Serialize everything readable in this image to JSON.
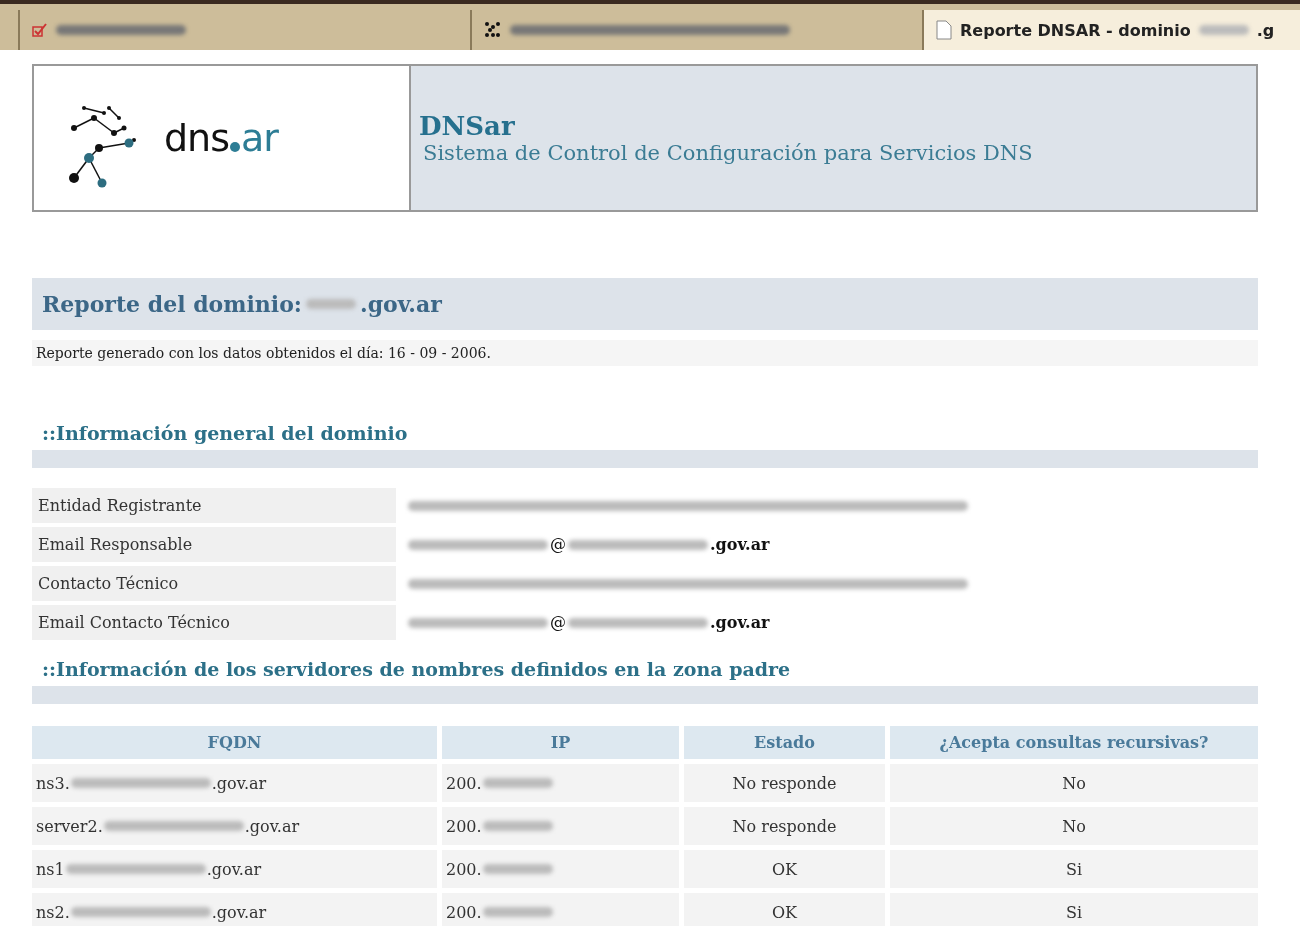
{
  "tabs": [
    {
      "selected": false,
      "parts": [
        {
          "kind": "blur"
        }
      ]
    },
    {
      "selected": false,
      "parts": [
        {
          "kind": "blur"
        }
      ]
    },
    {
      "selected": true,
      "parts": [
        {
          "kind": "text",
          "text": "Reporte DNSAR - dominio"
        },
        {
          "kind": "blur"
        },
        {
          "kind": "text",
          "text": ".g"
        }
      ]
    }
  ],
  "header": {
    "logo_text_1": "dns",
    "logo_text_2": "ar",
    "title": "DNSar",
    "subtitle": "Sistema de Control de Configuración para Servicios DNS"
  },
  "report": {
    "title_parts": [
      {
        "kind": "text",
        "text": "Reporte del dominio:"
      },
      {
        "kind": "blur"
      },
      {
        "kind": "text",
        "text": ".gov.ar"
      }
    ],
    "generated": "Reporte generado con los datos obtenidos el día: 16 - 09 - 2006."
  },
  "general_section": {
    "heading": "::Información general del dominio",
    "rows": [
      {
        "label": "Entidad Registrante",
        "parts": [
          {
            "kind": "blur"
          }
        ]
      },
      {
        "label": "Email Responsable",
        "parts": [
          {
            "kind": "blur"
          },
          {
            "kind": "text",
            "text": "@"
          },
          {
            "kind": "blur"
          },
          {
            "kind": "bold",
            "text": ".gov.ar"
          }
        ]
      },
      {
        "label": "Contacto Técnico",
        "parts": [
          {
            "kind": "blur"
          }
        ]
      },
      {
        "label": "Email Contacto Técnico",
        "parts": [
          {
            "kind": "blur"
          },
          {
            "kind": "text",
            "text": "@"
          },
          {
            "kind": "blur"
          },
          {
            "kind": "bold",
            "text": ".gov.ar"
          }
        ]
      }
    ]
  },
  "servers_section": {
    "heading": "::Información de los servidores de nombres definidos en la zona padre",
    "columns": [
      "FQDN",
      "IP",
      "Estado",
      "¿Acepta consultas recursivas?"
    ],
    "rows": [
      {
        "fqdn": [
          {
            "kind": "text",
            "text": "ns3."
          },
          {
            "kind": "blur"
          },
          {
            "kind": "text",
            "text": ".gov.ar"
          }
        ],
        "ip": [
          {
            "kind": "text",
            "text": "200."
          },
          {
            "kind": "blur"
          }
        ],
        "estado": "No responde",
        "recursiva": "No"
      },
      {
        "fqdn": [
          {
            "kind": "text",
            "text": "server2."
          },
          {
            "kind": "blur"
          },
          {
            "kind": "text",
            "text": ".gov.ar"
          }
        ],
        "ip": [
          {
            "kind": "text",
            "text": "200."
          },
          {
            "kind": "blur"
          }
        ],
        "estado": "No responde",
        "recursiva": "No"
      },
      {
        "fqdn": [
          {
            "kind": "text",
            "text": "ns1"
          },
          {
            "kind": "blur"
          },
          {
            "kind": "text",
            "text": ".gov.ar"
          }
        ],
        "ip": [
          {
            "kind": "text",
            "text": "200."
          },
          {
            "kind": "blur"
          }
        ],
        "estado": "OK",
        "recursiva": "Si"
      },
      {
        "fqdn": [
          {
            "kind": "text",
            "text": "ns2."
          },
          {
            "kind": "blur"
          },
          {
            "kind": "text",
            "text": ".gov.ar"
          }
        ],
        "ip": [
          {
            "kind": "text",
            "text": "200."
          },
          {
            "kind": "blur"
          }
        ],
        "estado": "OK",
        "recursiva": "Si"
      }
    ]
  }
}
